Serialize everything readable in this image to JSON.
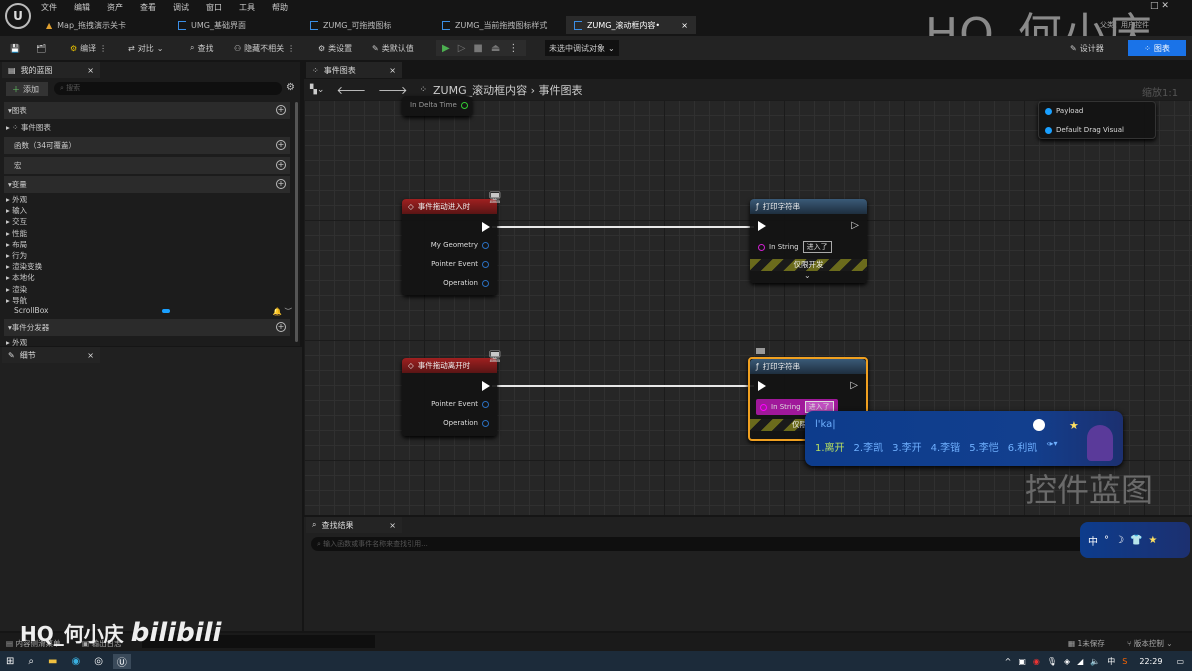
{
  "menu": [
    "文件",
    "编辑",
    "资产",
    "查看",
    "调试",
    "窗口",
    "工具",
    "帮助"
  ],
  "tabs": [
    "Map_拖拽演示关卡",
    "UMG_基础界面",
    "ZUMG_可拖拽图标",
    "ZUMG_当前拖拽图标样式",
    "ZUMG_滚动框内容•"
  ],
  "toolbar": {
    "compile": "编译",
    "diff": "对比",
    "find": "查找",
    "hide_unrelated": "隐藏不相关",
    "class_settings": "类设置",
    "class_defaults": "类默认值",
    "debug_target": "未选中调试对象",
    "designer": "设计器",
    "graph": "图表",
    "user_widget": "用户控件",
    "parent_label": "父类："
  },
  "watermark": {
    "top": "HQ_何小庆",
    "right": "控件蓝图",
    "bottom": "HQ_何小庆",
    "bilibili": "bilibili"
  },
  "my_blueprint": {
    "tab": "我的蓝图",
    "add": "添加",
    "search_placeholder": "搜索",
    "graphs": "图表",
    "event_graph": "事件图表",
    "functions": "函数（34可覆盖）",
    "macros": "宏",
    "variables": "变量",
    "var_groups": [
      "外观",
      "输入",
      "交互",
      "性能",
      "布局",
      "行为",
      "渲染变换",
      "本地化",
      "渲染",
      "导航"
    ],
    "scrollbox": "ScrollBox",
    "dispatchers": "事件分发器",
    "dispatcher_groups": [
      "外观"
    ]
  },
  "details": {
    "tab": "细节"
  },
  "graph": {
    "tab": "事件图表",
    "breadcrumb_root": "ZUMG_滚动框内容",
    "breadcrumb_leaf": "事件图表",
    "zoom": "缩放1:1",
    "partial_pin": "In Delta Time",
    "payload_pins": [
      "Payload",
      "Default Drag Visual"
    ],
    "event1": {
      "title": "事件拖动进入时",
      "pins": [
        "My Geometry",
        "Pointer Event",
        "Operation"
      ]
    },
    "event2": {
      "title": "事件拖动离开时",
      "pins": [
        "Pointer Event",
        "Operation"
      ]
    },
    "print1": {
      "title": "打印字符串",
      "in_string_label": "In String",
      "in_string_value": "进入了",
      "dev_only": "仅限开发"
    },
    "print2": {
      "title": "打印字符串",
      "in_string_label": "In String",
      "in_string_value": "进入了",
      "dev_only": "仅限"
    }
  },
  "ime": {
    "input": "l'ka",
    "candidates": [
      "1.离开",
      "2.李凯",
      "3.李开",
      "4.李锴",
      "5.李恺",
      "6.利凯"
    ],
    "status": "中"
  },
  "find_results": {
    "tab": "查找结果",
    "placeholder": "输入函数或事件名称来查找引用..."
  },
  "status_bar": {
    "content_drawer": "内容侧滑菜单",
    "output_log": "输出日志",
    "unsaved": "1未保存",
    "source_control": "版本控制"
  },
  "taskbar": {
    "time": "22:29",
    "ime": "中"
  }
}
